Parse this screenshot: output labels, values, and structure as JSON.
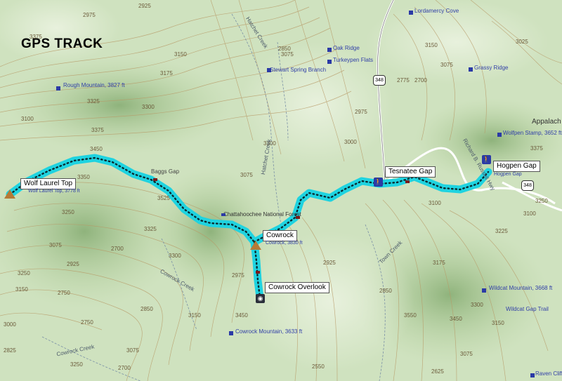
{
  "title": "GPS TRACK",
  "waypoints": {
    "wolf_laurel": "Wolf Laurel Top",
    "wolf_laurel_elev": "Wolf Laurel Top, 3778 ft",
    "cowrock": "Cowrock",
    "cowrock_elev": "Cowrock, 3830 ft",
    "cowrock_overlook": "Cowrock Overlook",
    "tesnatee_gap": "Tesnatee Gap",
    "hogpen_gap": "Hogpen Gap",
    "hogpen_gap_small": "Hogpen Gap"
  },
  "features": {
    "rough_mountain": "Rough Mountain, 3827 ft",
    "stewart_spring": "Stewart Spring Branch",
    "oak_ridge": "Oak Ridge",
    "turkeypen_flats": "Turkeypen Flats",
    "lordamercy_cove": "Lordamercy Cove",
    "grassy_ridge": "Grassy Ridge",
    "wolfpen_stamp": "Wolfpen Stamp, 3652 ft",
    "wildcat_mountain": "Wildcat Mountain, 3668 ft",
    "wildcat_gap_trail": "Wildcat Gap Trail",
    "cowrock_mountain": "Cowrock Mountain, 3633 ft",
    "raven_cliffs": "Raven Cliffs",
    "chattahoochee": "Chattahoochee National Forest",
    "appalach": "Appalach",
    "baggs_gap": "Baggs Gap"
  },
  "creeks": {
    "hatchet": "Hatchet Creek",
    "hatchet2": "Hatchet Creek",
    "town": "Town Creek",
    "cowrock1": "Cowrock Creek",
    "cowrock2": "Cowrock Creek",
    "richard": "Richard B. Russell Hwy"
  },
  "roads": {
    "r348a": "348",
    "r348b": "348"
  },
  "contours": [
    "2975",
    "2925",
    "3150",
    "3075",
    "3175",
    "3325",
    "3300",
    "3375",
    "3450",
    "3375",
    "3525",
    "3100",
    "3075",
    "3300",
    "3000",
    "2975",
    "2850",
    "3150",
    "3075",
    "2775",
    "2700",
    "3375",
    "3025",
    "3350",
    "3100",
    "3250",
    "3300",
    "3325",
    "3075",
    "2925",
    "2700",
    "2925",
    "3250",
    "3150",
    "3250",
    "3225",
    "3175",
    "3300",
    "3150",
    "3075",
    "2750",
    "3000",
    "2825",
    "2850",
    "3150",
    "3075",
    "2750",
    "3450",
    "3550",
    "2550",
    "2625",
    "2700",
    "2850",
    "3100",
    "3450",
    "3250",
    "2975"
  ],
  "colors": {
    "track": "#1fd3e0",
    "terrain_light": "#d8e8cb",
    "terrain_mid": "#b9d3a2",
    "terrain_dark": "#8fb37c",
    "contour": "#b79966",
    "feature_blue": "#2b3aa6"
  },
  "icons": {
    "summit": "mountain-summit-icon",
    "camera": "camera-icon",
    "hiker": "hiker-icon",
    "trail_cut": "trail-marker-icon"
  }
}
